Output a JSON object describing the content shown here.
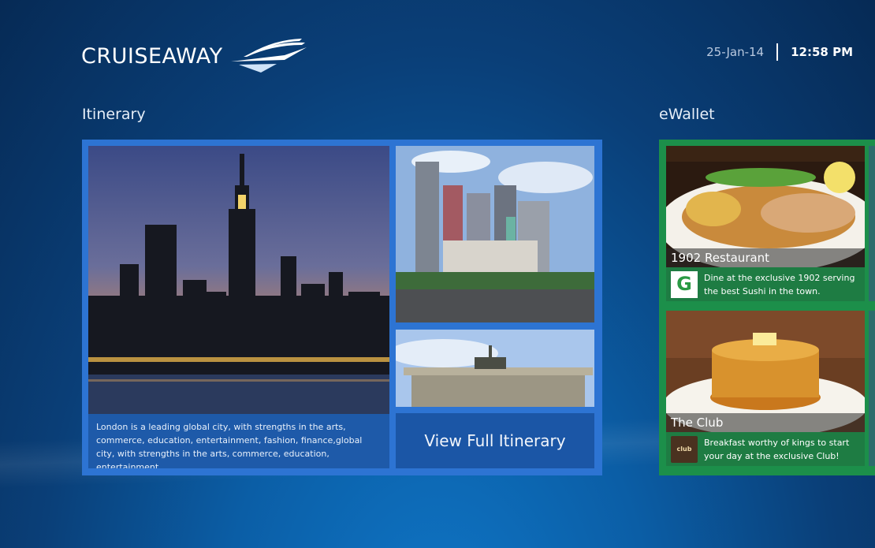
{
  "header": {
    "logo_text": "CRUISEAWAY",
    "date": "25-Jan-14",
    "time": "12:58 PM"
  },
  "itinerary": {
    "title": "Itinerary",
    "caption": "London is a leading global city, with strengths in the arts, commerce, education, entertainment, fashion, finance,global city, with strengths in the arts, commerce, education, entertainment..",
    "view_button": "View Full Itinerary"
  },
  "ewallet": {
    "title": "eWallet",
    "cards": [
      {
        "name": "1902 Restaurant",
        "description": "Dine at the exclusive 1902 serving the best Sushi in the town.",
        "icon_letter": "G"
      },
      {
        "name": "The Club",
        "description": "Breakfast worthy of kings to start your day at the exclusive Club!",
        "icon_text": "club"
      }
    ]
  },
  "colors": {
    "itinerary_panel": "#2d74d3",
    "ewallet_panel": "#1c8f4a",
    "background": "#0b5ea6"
  },
  "icons": [
    "ship-logo-icon",
    "g-logo-icon",
    "club-logo-icon"
  ]
}
